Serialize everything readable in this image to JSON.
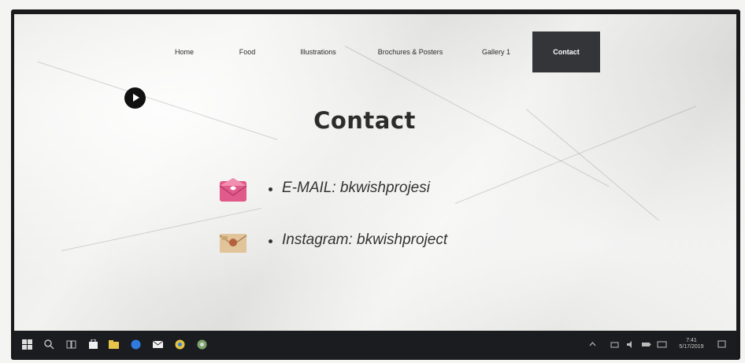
{
  "nav": {
    "items": [
      {
        "label": "Home"
      },
      {
        "label": "Food"
      },
      {
        "label": "Illustrations"
      },
      {
        "label": "Brochures & Posters"
      },
      {
        "label": "Gallery 1"
      },
      {
        "label": "Contact"
      }
    ],
    "active_index": 5,
    "active_bg": "#333538"
  },
  "page": {
    "title": "Contact"
  },
  "contacts": [
    {
      "icon": "email-envelope-icon",
      "text": "E-MAIL: bkwishprojesi",
      "icon_color": "#e05a8a"
    },
    {
      "icon": "instagram-envelope-icon",
      "text": "Instagram: bkwishproject",
      "icon_color": "#d9b88a"
    }
  ],
  "taskbar": {
    "icons": [
      "windows-start-icon",
      "search-icon",
      "task-view-icon",
      "store-icon",
      "file-explorer-icon",
      "edge-icon",
      "mail-icon",
      "chrome-icon",
      "app-icon"
    ],
    "clock_time": "7:41",
    "clock_date": "5/17/2019"
  },
  "colors": {
    "taskbar": "#1b1c1f",
    "title": "#2c2c2c"
  }
}
